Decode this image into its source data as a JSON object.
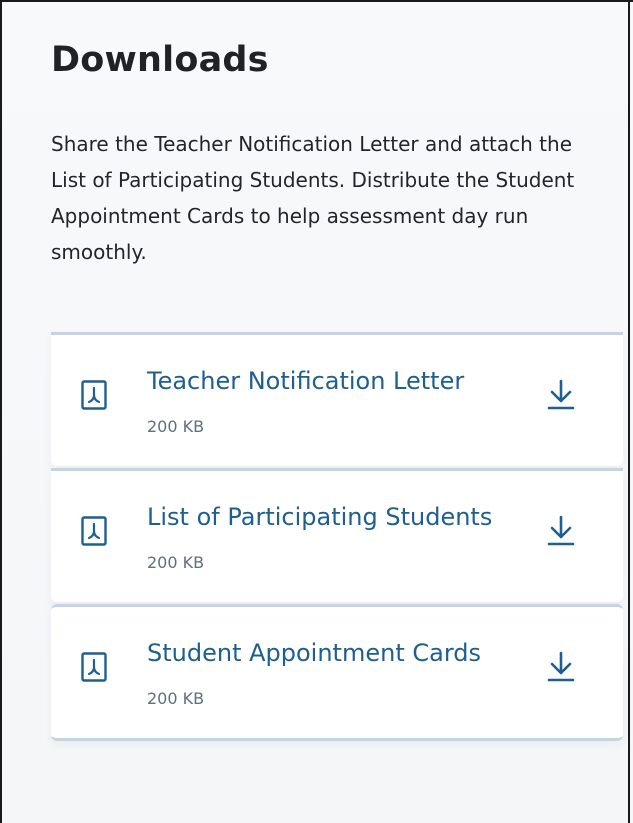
{
  "downloads": {
    "title": "Downloads",
    "description": "Share the Teacher Notification Letter and attach the List of Participating Students. Distribute the Student Appointment Cards to help assessment day run smoothly.",
    "files": [
      {
        "name": "Teacher Notification Letter",
        "size": "200 KB",
        "icon": "pdf-icon",
        "action_icon": "download-icon"
      },
      {
        "name": "List of Participating Students",
        "size": "200 KB",
        "icon": "pdf-icon",
        "action_icon": "download-icon"
      },
      {
        "name": "Student Appointment Cards",
        "size": "200 KB",
        "icon": "pdf-icon",
        "action_icon": "download-icon"
      }
    ]
  },
  "colors": {
    "link": "#1d5f8f",
    "divider": "#c5d4e3",
    "text": "#22262a",
    "muted": "#5f6f7e"
  }
}
